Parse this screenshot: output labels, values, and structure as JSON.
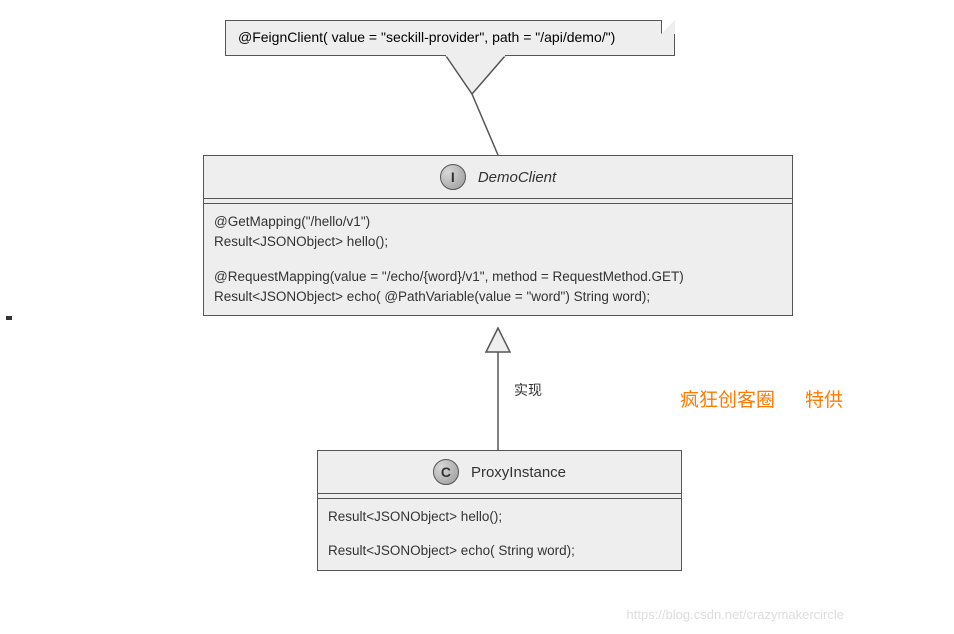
{
  "note": {
    "text": "@FeignClient( value = \"seckill-provider\", path = \"/api/demo/\")"
  },
  "interface": {
    "stereotype": "I",
    "name": "DemoClient",
    "methods": [
      {
        "annotation": "@GetMapping(\"/hello/v1\")",
        "signature": "Result<JSONObject> hello();"
      },
      {
        "annotation": "@RequestMapping(value = \"/echo/{word}/v1\", method = RequestMethod.GET)",
        "signature": "Result<JSONObject> echo( @PathVariable(value = \"word\") String word);"
      }
    ]
  },
  "proxyClass": {
    "stereotype": "C",
    "name": "ProxyInstance",
    "methods": [
      {
        "signature": "Result<JSONObject> hello();"
      },
      {
        "signature": "Result<JSONObject> echo( String word);"
      }
    ]
  },
  "relation": {
    "label": "实现"
  },
  "orangeText1": "疯狂创客圈",
  "orangeText2": "特供",
  "watermark": "https://blog.csdn.net/crazymakercircle"
}
